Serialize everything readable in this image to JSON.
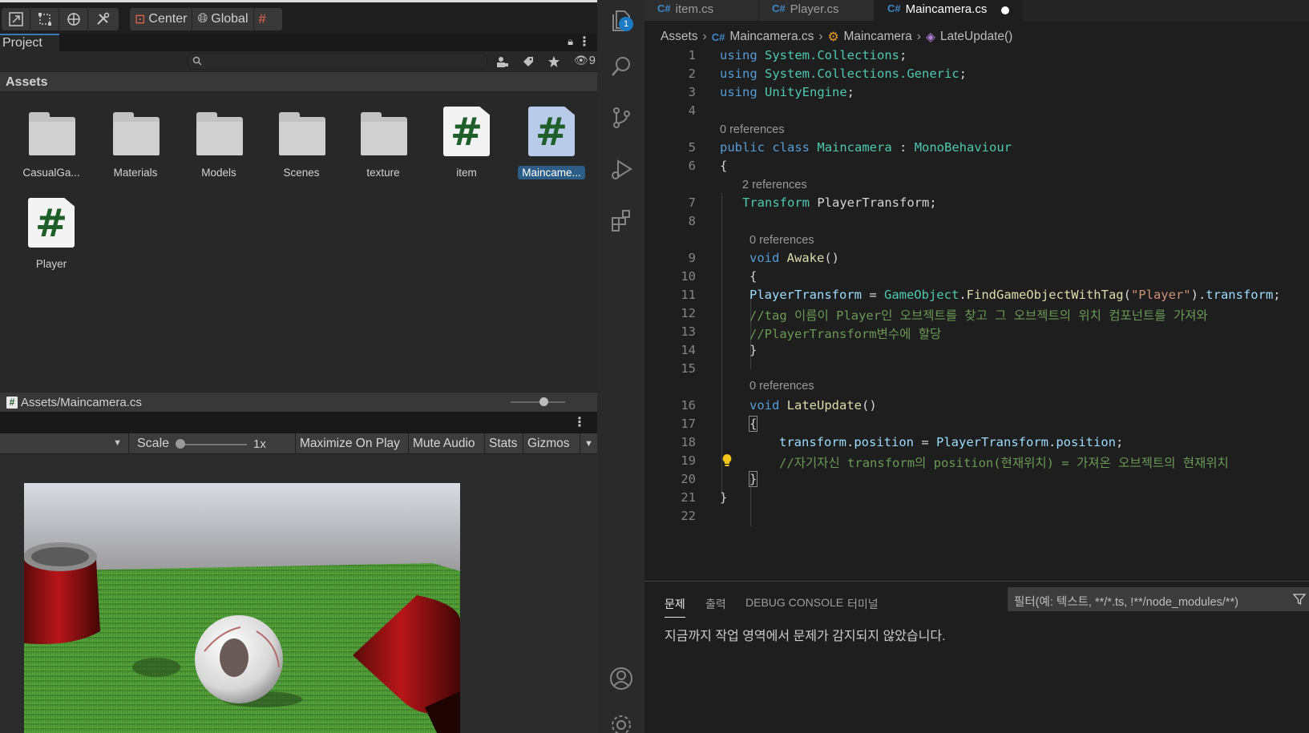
{
  "unity": {
    "toolbar": {
      "center_label": "Center",
      "global_label": "Global"
    },
    "project": {
      "tab_label": "Project",
      "search": {
        "placeholder": ""
      },
      "hidden_count": "9",
      "breadcrumb": "Assets",
      "assets": [
        {
          "name": "CasualGa...",
          "type": "folder"
        },
        {
          "name": "Materials",
          "type": "folder"
        },
        {
          "name": "Models",
          "type": "folder"
        },
        {
          "name": "Scenes",
          "type": "folder"
        },
        {
          "name": "texture",
          "type": "folder"
        },
        {
          "name": "item",
          "type": "script"
        },
        {
          "name": "Maincame...",
          "type": "script",
          "selected": true
        },
        {
          "name": "Player",
          "type": "script"
        }
      ],
      "selected_path": "Assets/Maincamera.cs"
    },
    "game": {
      "scale_label": "Scale",
      "scale_value": "1x",
      "maximize_label": "Maximize On Play",
      "mute_label": "Mute Audio",
      "stats_label": "Stats",
      "gizmos_label": "Gizmos"
    }
  },
  "vscode": {
    "activity": {
      "explorer_badge": "1"
    },
    "tabs": [
      {
        "label": "item.cs"
      },
      {
        "label": "Player.cs"
      },
      {
        "label": "Maincamera.cs",
        "active": true,
        "dirty": true
      }
    ],
    "breadcrumbs": {
      "root": "Assets",
      "file": "Maincamera.cs",
      "class": "Maincamera",
      "method": "LateUpdate()"
    },
    "code": {
      "line_numbers": [
        "1",
        "2",
        "3",
        "4",
        "5",
        "6",
        "7",
        "8",
        "9",
        "10",
        "11",
        "12",
        "13",
        "14",
        "15",
        "16",
        "17",
        "18",
        "19",
        "20",
        "21",
        "22"
      ],
      "lens": {
        "class_refs": "0 references",
        "field_refs": "2 references",
        "awake_refs": "0 references",
        "lateupdate_refs": "0 references"
      },
      "l1": {
        "kw": "using",
        "ns": "System.Collections",
        "end": ";"
      },
      "l2": {
        "kw": "using",
        "ns": "System.Collections.Generic",
        "end": ";"
      },
      "l3": {
        "kw": "using",
        "ns": "UnityEngine",
        "end": ";"
      },
      "l5": {
        "kw1": "public",
        "kw2": "class",
        "name": "Maincamera",
        "colon": " : ",
        "base": "MonoBehaviour"
      },
      "l6": "{",
      "l7": {
        "type": "Transform",
        "rest": " PlayerTransform;"
      },
      "l9": {
        "kw": "void",
        "fn": "Awake",
        "rest": "()"
      },
      "l10": "{",
      "l11": {
        "var": "PlayerTransform",
        "eq": " = ",
        "ty": "GameObject",
        "dot": ".",
        "fn": "FindGameObjectWithTag",
        "open": "(",
        "str": "\"Player\"",
        "close": ").",
        "prop": "transform",
        "end": ";"
      },
      "l12": "//tag 이름이 Player인 오브젝트를 찾고 그 오브젝트의 위치 컴포넌트를 가져와",
      "l13": "//PlayerTransform변수에 할당",
      "l14": "}",
      "l16": {
        "kw": "void",
        "fn": "LateUpdate",
        "rest": "()"
      },
      "l17": "{",
      "l18": {
        "a": "transform",
        "b": ".",
        "c": "position",
        "d": " = ",
        "e": "PlayerTransform",
        "f": ".",
        "g": "position",
        "h": ";"
      },
      "l19": "//자기자신 transform의 position(현재위치) = 가져온 오브젝트의 현재위치",
      "l20": "}",
      "l21": "}"
    },
    "panel": {
      "tabs": [
        "문제",
        "출력",
        "DEBUG CONSOLE",
        "터미널"
      ],
      "filter_placeholder": "필터(예: 텍스트, **/*.ts, !**/node_modules/**)",
      "message": "지금까지 작업 영역에서 문제가 감지되지 않았습니다."
    }
  }
}
